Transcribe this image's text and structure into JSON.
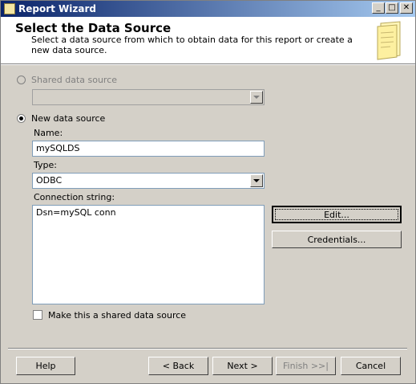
{
  "window": {
    "title": "Report Wizard",
    "minimize_glyph": "_",
    "maximize_glyph": "□",
    "close_glyph": "✕"
  },
  "header": {
    "title": "Select the Data Source",
    "subtitle": "Select a data source from which to obtain data for this report or create a new data source.",
    "icon": "wizard-page-icon"
  },
  "shared_source": {
    "label": "Shared data source",
    "selected": false,
    "enabled": false,
    "dropdown_value": ""
  },
  "new_source": {
    "label": "New data source",
    "selected": true,
    "name_label": "Name:",
    "name_value": "mySQLDS",
    "type_label": "Type:",
    "type_value": "ODBC",
    "connection_label": "Connection string:",
    "connection_value": "Dsn=mySQL conn",
    "edit_button": "Edit...",
    "credentials_button": "Credentials...",
    "shared_checkbox_label": "Make this a shared data source",
    "shared_checkbox_checked": false
  },
  "footer": {
    "help": "Help",
    "back": "< Back",
    "next": "Next >",
    "finish": "Finish >>|",
    "cancel": "Cancel"
  }
}
